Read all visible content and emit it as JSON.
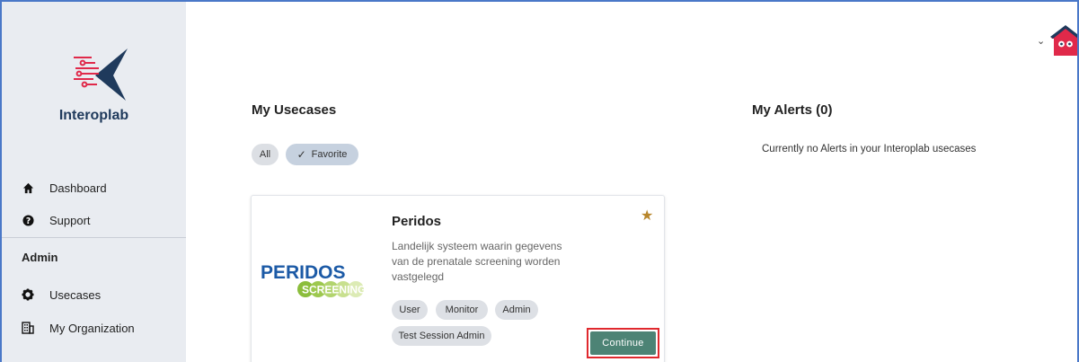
{
  "sidebar": {
    "brand": "Interoplab",
    "nav": [
      {
        "label": "Dashboard",
        "icon": "home-icon"
      },
      {
        "label": "Support",
        "icon": "help-icon"
      }
    ],
    "admin_label": "Admin",
    "admin_nav": [
      {
        "label": "Usecases",
        "icon": "gear-icon"
      },
      {
        "label": "My Organization",
        "icon": "building-icon"
      }
    ]
  },
  "usecases": {
    "title": "My Usecases",
    "filters": [
      {
        "label": "All",
        "selected": false
      },
      {
        "label": "Favorite",
        "selected": true
      }
    ],
    "card": {
      "logo_text": "PERIDOS",
      "logo_subtext": "SCREENING",
      "title": "Peridos",
      "description": "Landelijk systeem waarin gegevens van de prenatale screening worden vastgelegd",
      "favorite": true,
      "roles": [
        "User",
        "Monitor",
        "Admin",
        "Test Session Admin"
      ],
      "continue_label": "Continue"
    }
  },
  "alerts": {
    "title": "My Alerts (0)",
    "empty_message": "Currently no Alerts in your Interoplab usecases"
  },
  "colors": {
    "sidebar_bg": "#e9ecf1",
    "brand_text": "#1f3a5c",
    "logo_red": "#e0294a",
    "logo_navy": "#1f3a5c",
    "continue_button": "#4d8375",
    "highlight_border": "#e0292e",
    "favorite_star": "#b8862b"
  }
}
